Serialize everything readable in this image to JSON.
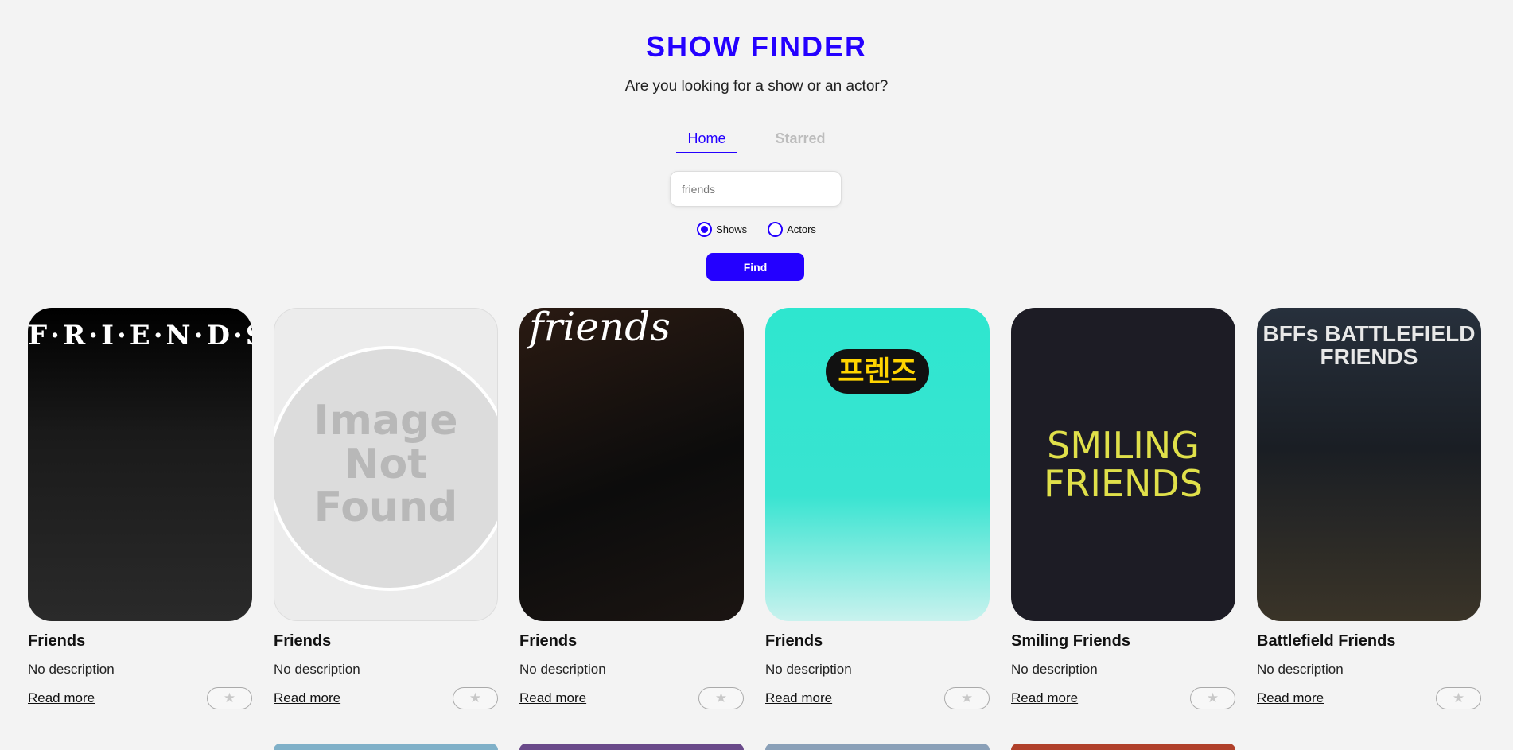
{
  "header": {
    "title": "SHOW FINDER",
    "subtitle": "Are you looking for a show or an actor?"
  },
  "nav": {
    "home": "Home",
    "starred": "Starred"
  },
  "search": {
    "value": "friends",
    "placeholder": ""
  },
  "radios": {
    "shows": "Shows",
    "actors": "Actors",
    "selected": "Shows"
  },
  "find_label": "Find",
  "cards": [
    {
      "title": "Friends",
      "description": "No description",
      "read_more": "Read more",
      "poster_text": "F·R·I·E·N·D·S"
    },
    {
      "title": "Friends",
      "description": "No description",
      "read_more": "Read more",
      "poster_text": "Image Not Found"
    },
    {
      "title": "Friends",
      "description": "No description",
      "read_more": "Read more",
      "poster_text": "friends"
    },
    {
      "title": "Friends",
      "description": "No description",
      "read_more": "Read more",
      "poster_text": "프렌즈"
    },
    {
      "title": "Smiling Friends",
      "description": "No description",
      "read_more": "Read more",
      "poster_text": "SMILING FRIENDS"
    },
    {
      "title": "Battlefield Friends",
      "description": "No description",
      "read_more": "Read more",
      "poster_text": "BFFs BATTLEFIELD FRIENDS"
    }
  ],
  "star_icon": "star-icon",
  "colors": {
    "accent": "#2400ff",
    "background": "#f3f3f3",
    "inactive_nav": "#bdbdbd"
  }
}
